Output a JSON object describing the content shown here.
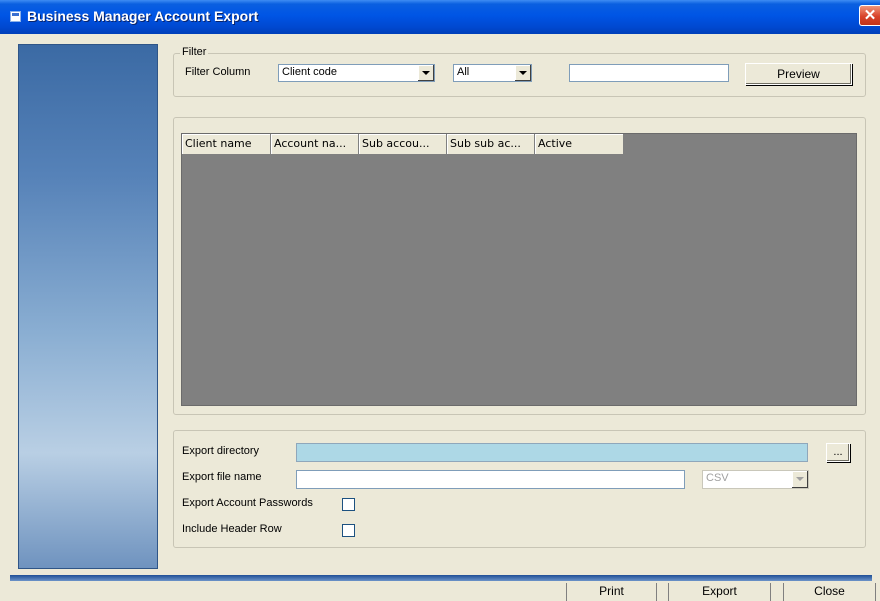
{
  "window": {
    "title": "Business Manager Account Export",
    "close_glyph": "✕"
  },
  "filter": {
    "group_label": "Filter",
    "column_label": "Filter Column",
    "column_value": "Client code",
    "operator_value": "All",
    "search_value": "",
    "preview_label": "Preview"
  },
  "grid": {
    "columns": [
      "Client name",
      "Account na...",
      "Sub accou...",
      "Sub sub ac...",
      "Active"
    ]
  },
  "export": {
    "directory_label": "Export directory",
    "directory_value": "",
    "browse_label": "...",
    "filename_label": "Export file name",
    "filename_value": "",
    "format_value": "CSV",
    "passwords_label": "Export Account Passwords",
    "passwords_checked": false,
    "header_label": "Include Header Row",
    "header_checked": false
  },
  "footer": {
    "print_label": "Print",
    "export_label": "Export",
    "close_label": "Close"
  },
  "colors": {
    "titlebar": "#0055e5",
    "grid_bg": "#808080",
    "directory_bg": "#add8e6",
    "window_bg": "#ece9d8"
  }
}
